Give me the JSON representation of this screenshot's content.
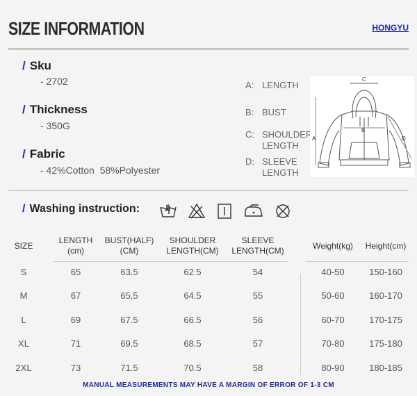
{
  "header": {
    "title": "SIZE INFORMATION",
    "brand": "HONGYU"
  },
  "specs": {
    "sku": {
      "label": "Sku",
      "value": "- 2702"
    },
    "thickness": {
      "label": "Thickness",
      "value": "- 350G"
    },
    "fabric": {
      "label": "Fabric",
      "value": "- 42%Cotton  58%Polyester"
    }
  },
  "dimensions": [
    {
      "key": "A:",
      "label": "LENGTH"
    },
    {
      "key": "B:",
      "label": "BUST"
    },
    {
      "key": "C:",
      "label": "SHOULDER LENGTH"
    },
    {
      "key": "D:",
      "label": "SLEEVE LENGTH"
    }
  ],
  "diagram": {
    "labels": [
      "A",
      "B",
      "C",
      "D"
    ]
  },
  "washing": {
    "label": "Washing instruction:",
    "icons": [
      "hand-wash-icon",
      "do-not-bleach-icon",
      "line-dry-icon",
      "iron-icon",
      "do-not-dry-clean-icon"
    ]
  },
  "table": {
    "headers": {
      "size": "SIZE",
      "length": "LENGTH",
      "length_unit": "(cm)",
      "bust": "BUST(HALF)",
      "bust_unit": "(CM)",
      "shoulder": "SHOULDER",
      "shoulder_unit": "LENGTH(CM)",
      "sleeve": "SLEEVE",
      "sleeve_unit": "LENGTH(CM)",
      "weight": "Weight(kg)",
      "height": "Height(cm)"
    },
    "rows": [
      {
        "size": "S",
        "length": "65",
        "bust": "63.5",
        "shoulder": "62.5",
        "sleeve": "54",
        "weight": "40-50",
        "height": "150-160"
      },
      {
        "size": "M",
        "length": "67",
        "bust": "65.5",
        "shoulder": "64.5",
        "sleeve": "55",
        "weight": "50-60",
        "height": "160-170"
      },
      {
        "size": "L",
        "length": "69",
        "bust": "67.5",
        "shoulder": "66.5",
        "sleeve": "56",
        "weight": "60-70",
        "height": "170-175"
      },
      {
        "size": "XL",
        "length": "71",
        "bust": "69.5",
        "shoulder": "68.5",
        "sleeve": "57",
        "weight": "70-80",
        "height": "175-180"
      },
      {
        "size": "2XL",
        "length": "73",
        "bust": "71.5",
        "shoulder": "70.5",
        "sleeve": "58",
        "weight": "80-90",
        "height": "180-185"
      }
    ]
  },
  "footer": {
    "note": "MANUAL MEASUREMENTS MAY HAVE A MARGIN OF ERROR OF 1-3 CM"
  },
  "colors": {
    "accent": "#1f2a9a",
    "background": "#f4f4f4",
    "text": "#333333"
  }
}
